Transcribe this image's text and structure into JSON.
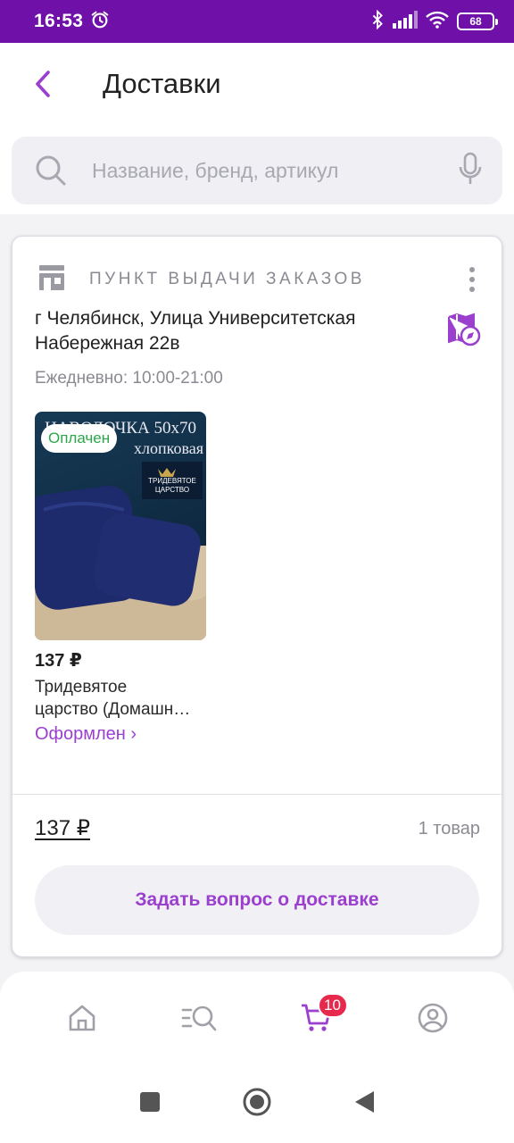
{
  "status_bar": {
    "time": "16:53",
    "battery": "68"
  },
  "header": {
    "title": "Доставки",
    "search_placeholder": "Название, бренд, артикул"
  },
  "delivery": {
    "pickup_label": "ПУНКТ ВЫДАЧИ ЗАКАЗОВ",
    "address_line1": "г Челябинск, Улица Университетская",
    "address_line2": "Набережная 22в",
    "hours": "Ежедневно: 10:00-21:00",
    "product": {
      "badge": "Оплачен",
      "image_text_top": "НАВОЛОЧКА 50x70",
      "image_text_mid": "хлопковая",
      "image_brand": "ТРИДЕВЯТОЕ ЦАРСТВО",
      "price": "137 ₽",
      "name_line1": "Тридевятое",
      "name_line2": "царство (Домашн…",
      "status": "Оформлен ›"
    },
    "total": "137 ₽",
    "count": "1 товар",
    "ask_button": "Задать вопрос о доставке"
  },
  "bottom_nav": {
    "cart_badge": "10"
  },
  "colors": {
    "accent": "#9b3fcf",
    "status_bar": "#6f10a8",
    "badge_red": "#e6294c",
    "paid_green": "#2ba84a"
  }
}
